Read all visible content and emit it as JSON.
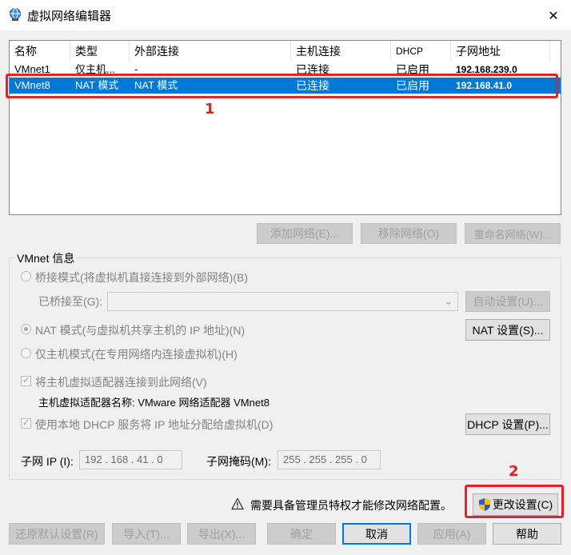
{
  "window": {
    "title": "虚拟网络编辑器",
    "close_glyph": "✕"
  },
  "list": {
    "columns": [
      "名称",
      "类型",
      "外部连接",
      "主机连接",
      "DHCP",
      "子网地址"
    ],
    "rows": [
      {
        "name": "VMnet1",
        "type": "仅主机...",
        "external": "-",
        "host": "已连接",
        "dhcp": "已启用",
        "subnet": "192.168.239.0",
        "selected": false
      },
      {
        "name": "VMnet8",
        "type": "NAT 模式",
        "external": "NAT 模式",
        "host": "已连接",
        "dhcp": "已启用",
        "subnet": "192.168.41.0",
        "selected": true
      }
    ]
  },
  "list_buttons": {
    "add": "添加网络(E)...",
    "remove": "移除网络(O)",
    "rename": "重命名网络(W)..."
  },
  "vmnet_info": {
    "group_title": "VMnet 信息",
    "bridged_label": "桥接模式(将虚拟机直接连接到外部网络)(B)",
    "bridged_to_label": "已桥接至(G):",
    "bridged_to_value": "",
    "auto_settings": "自动设置(U)...",
    "nat_label": "NAT 模式(与虚拟机共享主机的 IP 地址)(N)",
    "nat_settings": "NAT 设置(S)...",
    "hostonly_label": "仅主机模式(在专用网络内连接虚拟机)(H)",
    "connect_adapter_label": "将主机虚拟适配器连接到此网络(V)",
    "adapter_name_label": "主机虚拟适配器名称: VMware 网络适配器 VMnet8",
    "dhcp_label": "使用本地 DHCP 服务将 IP 地址分配给虚拟机(D)",
    "dhcp_settings": "DHCP 设置(P)...",
    "subnet_ip_label": "子网 IP (I):",
    "subnet_ip_value": "192 . 168 . 41 . 0",
    "subnet_mask_label": "子网掩码(M):",
    "subnet_mask_value": "255 . 255 . 255 . 0",
    "selected_mode": "nat",
    "connect_adapter_checked": true,
    "dhcp_checked": true
  },
  "admin": {
    "warning_text": "需要具备管理员特权才能修改网络配置。",
    "change_settings": "更改设置(C)"
  },
  "footer": {
    "restore_defaults": "还原默认设置(R)",
    "import": "导入(T)...",
    "export": "导出(X)...",
    "ok": "确定",
    "cancel": "取消",
    "apply": "应用(A)",
    "help": "帮助"
  },
  "annotations": {
    "marker_1": "1",
    "marker_2": "2"
  },
  "colors": {
    "selection": "#0078d7",
    "annotation_red": "#e8202a",
    "shield_blue": "#2a5cc8",
    "shield_yellow": "#f5c400"
  }
}
